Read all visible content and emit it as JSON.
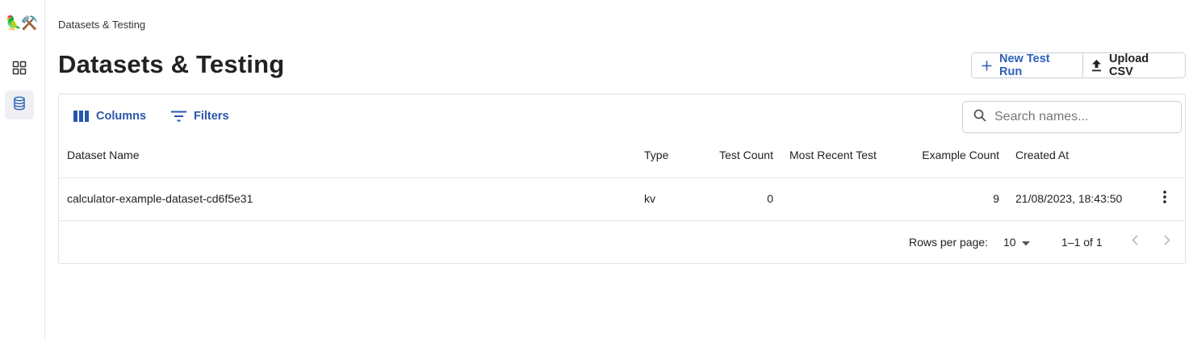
{
  "app": {
    "logo": "🦜⚒️",
    "nav": [
      {
        "name": "dashboard",
        "icon": "grid-icon"
      },
      {
        "name": "datasets",
        "icon": "database-icon",
        "active": true
      }
    ]
  },
  "breadcrumb": "Datasets & Testing",
  "page_title": "Datasets & Testing",
  "actions": {
    "new_test_run": "New Test Run",
    "upload_csv": "Upload CSV"
  },
  "toolbar": {
    "columns": "Columns",
    "filters": "Filters",
    "search_placeholder": "Search names..."
  },
  "table": {
    "headers": {
      "name": "Dataset Name",
      "type": "Type",
      "test_count": "Test Count",
      "most_recent_test": "Most Recent Test",
      "example_count": "Example Count",
      "created_at": "Created At"
    },
    "rows": [
      {
        "name": "calculator-example-dataset-cd6f5e31",
        "type": "kv",
        "test_count": "0",
        "most_recent_test": "",
        "example_count": "9",
        "created_at": "21/08/2023, 18:43:50"
      }
    ]
  },
  "pagination": {
    "rows_per_page_label": "Rows per page:",
    "rows_per_page": "10",
    "range": "1–1 of 1"
  },
  "colors": {
    "accent": "#2d5fb8",
    "border": "#e3e3e3",
    "active_nav_bg": "#eef0f3"
  }
}
